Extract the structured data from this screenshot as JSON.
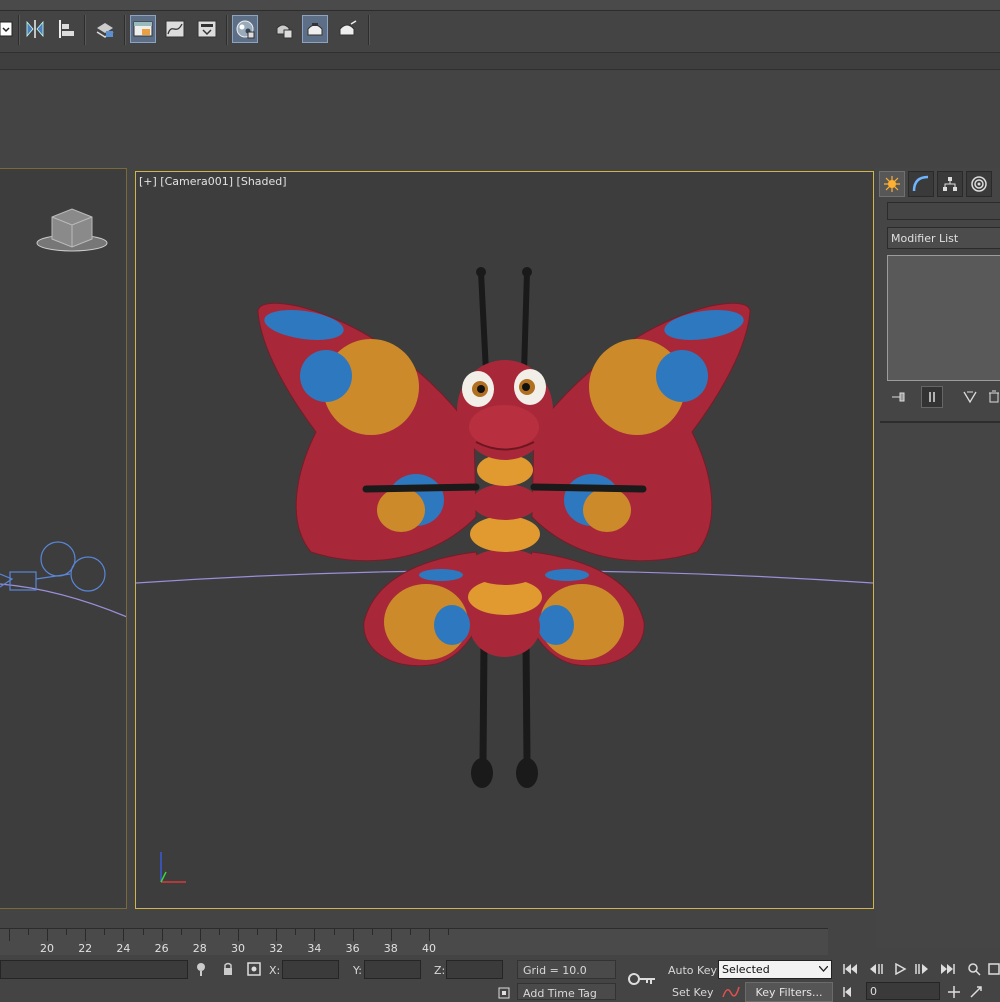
{
  "toolbar": {
    "buttons": [
      {
        "name": "select-filter-dropdown-icon"
      },
      {
        "name": "mirror-icon"
      },
      {
        "name": "align-icon"
      },
      {
        "name": "layer-explorer-icon"
      },
      {
        "name": "toggle-ribbon-icon"
      },
      {
        "name": "curve-editor-icon"
      },
      {
        "name": "schematic-view-icon"
      },
      {
        "name": "material-editor-icon"
      },
      {
        "name": "render-setup-icon"
      },
      {
        "name": "rendered-frame-window-icon"
      },
      {
        "name": "render-production-icon"
      }
    ]
  },
  "viewport": {
    "label": "[+] [Camera001] [Shaded]"
  },
  "command_panel": {
    "tabs": [
      {
        "name": "create-tab-icon"
      },
      {
        "name": "modify-tab-icon"
      },
      {
        "name": "hierarchy-tab-icon"
      },
      {
        "name": "motion-tab-icon"
      }
    ],
    "name_field_value": "",
    "modifier_list_label": "Modifier List"
  },
  "timeline": {
    "ticks": [
      20,
      22,
      24,
      26,
      28,
      30,
      32,
      34,
      36,
      38,
      40
    ]
  },
  "status": {
    "x_label": "X:",
    "y_label": "Y:",
    "z_label": "Z:",
    "x_value": "",
    "y_value": "",
    "z_value": "",
    "grid_text": "Grid = 10.0",
    "add_time_tag": "Add Time Tag",
    "auto_key": "Auto Key",
    "set_key": "Set Key",
    "selected_option": "Selected",
    "key_filters": "Key Filters...",
    "frame_value": "0"
  },
  "colors": {
    "viewport_border_active": "#d0b54a",
    "wing_red": "#a8283a",
    "wing_orange": "#cc8a2a",
    "wing_blue": "#2e78bf",
    "body_orange": "#e09a30",
    "horizon_line": "#9a8fd8"
  }
}
